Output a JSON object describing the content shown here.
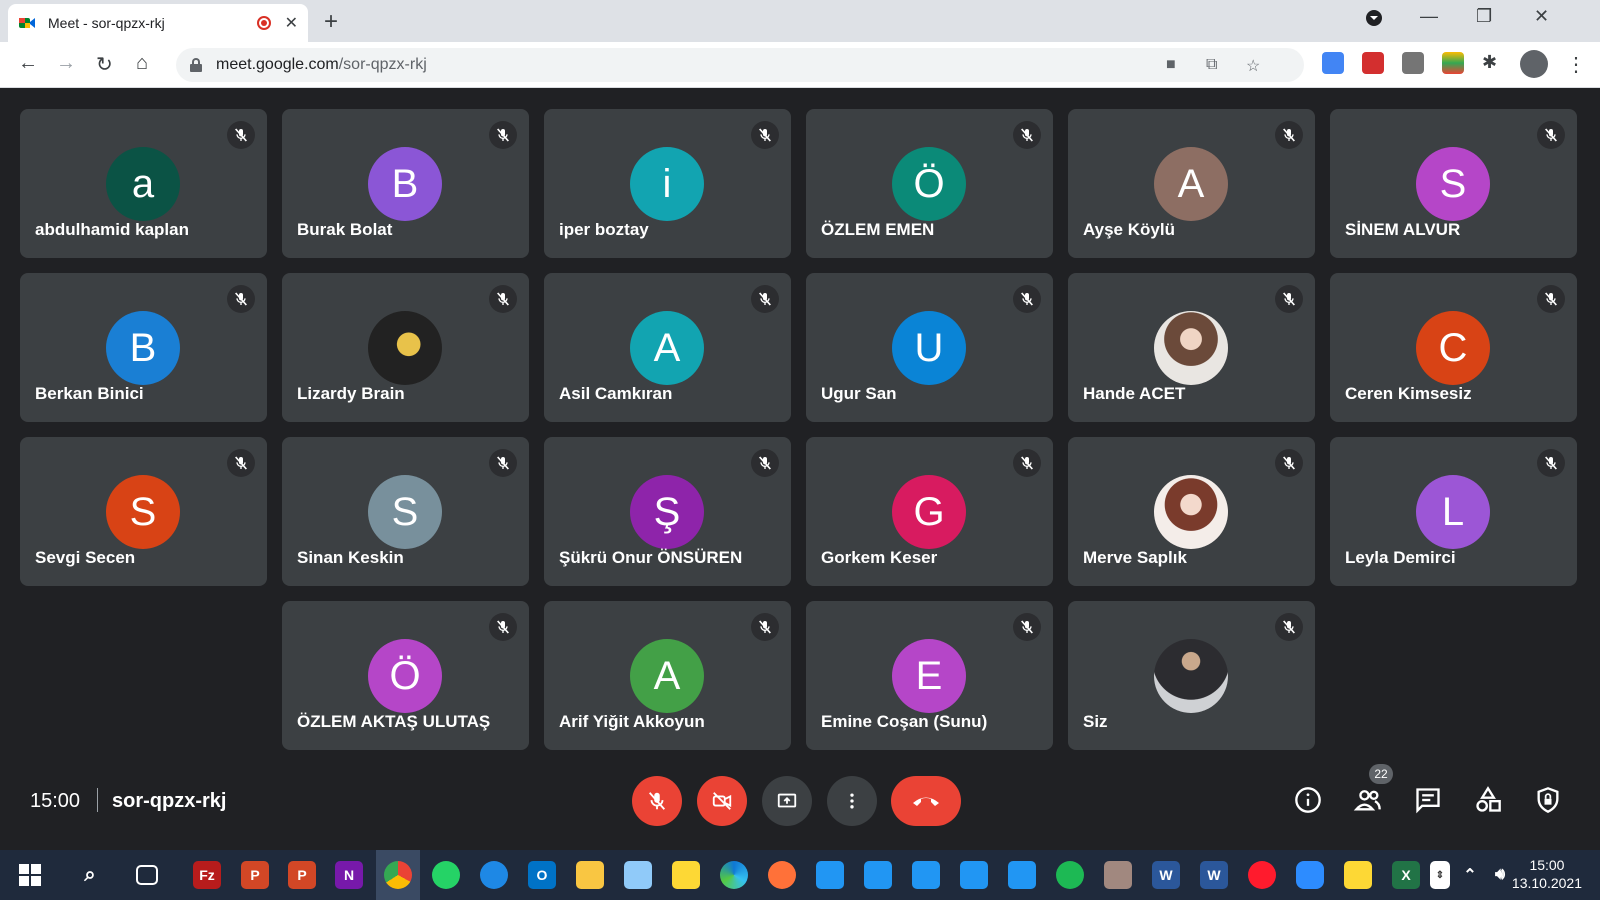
{
  "browser": {
    "tab_title": "Meet - sor-qpzx-rkj",
    "url_host": "meet.google.com",
    "url_path": "/sor-qpzx-rkj"
  },
  "participants": [
    {
      "name": "abdulhamid kaplan",
      "initial": "a",
      "color": "#0b5345",
      "photo": ""
    },
    {
      "name": "Burak Bolat",
      "initial": "B",
      "color": "#8b56d6",
      "photo": ""
    },
    {
      "name": "iper boztay",
      "initial": "i",
      "color": "#12a4b1",
      "photo": ""
    },
    {
      "name": "ÖZLEM EMEN",
      "initial": "Ö",
      "color": "#0b8a78",
      "photo": ""
    },
    {
      "name": "Ayşe Köylü",
      "initial": "A",
      "color": "#8d6e63",
      "photo": ""
    },
    {
      "name": "SİNEM ALVUR",
      "initial": "S",
      "color": "#b546c8",
      "photo": ""
    },
    {
      "name": "Berkan Binici",
      "initial": "B",
      "color": "#1a7fd4",
      "photo": ""
    },
    {
      "name": "Lizardy Brain",
      "initial": "",
      "color": "#222222",
      "photo": "photo1"
    },
    {
      "name": "Asil Camkıran",
      "initial": "A",
      "color": "#12a4b1",
      "photo": ""
    },
    {
      "name": "Ugur San",
      "initial": "U",
      "color": "#0a84d6",
      "photo": ""
    },
    {
      "name": "Hande ACET",
      "initial": "",
      "color": "#e9e6e2",
      "photo": "photo2"
    },
    {
      "name": "Ceren Kimsesiz",
      "initial": "C",
      "color": "#d84315",
      "photo": ""
    },
    {
      "name": "Sevgi Secen",
      "initial": "S",
      "color": "#d84315",
      "photo": ""
    },
    {
      "name": "Sinan Keskin",
      "initial": "S",
      "color": "#78909c",
      "photo": ""
    },
    {
      "name": "Şükrü Onur ÖNSÜREN",
      "initial": "Ş",
      "color": "#8e24aa",
      "photo": ""
    },
    {
      "name": "Gorkem Keser",
      "initial": "G",
      "color": "#d81b60",
      "photo": ""
    },
    {
      "name": "Merve Saplık",
      "initial": "",
      "color": "#f4ede9",
      "photo": "photo3"
    },
    {
      "name": "Leyla Demirci",
      "initial": "L",
      "color": "#9c56d6",
      "photo": ""
    },
    {
      "name": "ÖZLEM AKTAŞ ULUTAŞ",
      "initial": "Ö",
      "color": "#b546c8",
      "photo": ""
    },
    {
      "name": "Arif Yiğit Akkoyun",
      "initial": "A",
      "color": "#43a047",
      "photo": ""
    },
    {
      "name": "Emine Coşan (Sunu)",
      "initial": "E",
      "color": "#b546c8",
      "photo": ""
    },
    {
      "name": "Siz",
      "initial": "",
      "color": "#cfd1d4",
      "photo": "photo4"
    }
  ],
  "meeting": {
    "time": "15:00",
    "code": "sor-qpzx-rkj",
    "participant_count": "22"
  },
  "taskbar": {
    "clock_time": "15:00",
    "clock_date": "13.10.2021"
  }
}
